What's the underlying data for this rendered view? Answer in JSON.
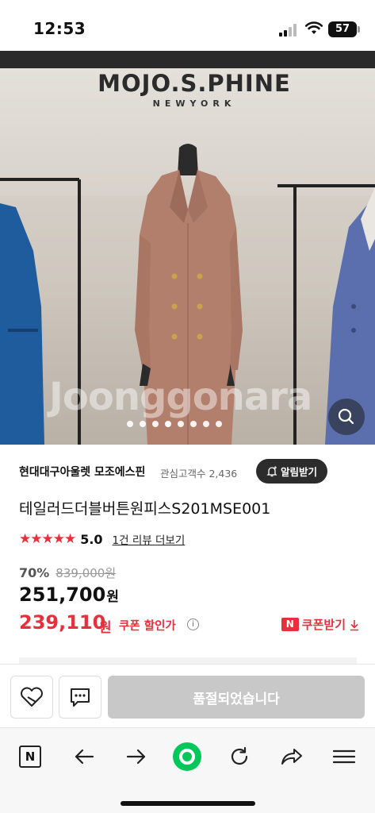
{
  "status_bar": {
    "time": "12:53",
    "battery": "57"
  },
  "hero": {
    "brand": "MOJO.S.PHINE",
    "brand_sub": "NEWYORK",
    "watermark": "Joonggonara",
    "carousel_dots": 8,
    "active_dot": 4,
    "icons": {
      "zoom": "search-icon"
    }
  },
  "store": {
    "name": "현대대구아울렛 모조에스핀",
    "followers": "관심고객수 2,436",
    "alarm_label": "알림받기"
  },
  "product": {
    "title": "테일러드더블버튼원피스S201MSE001",
    "stars": "★★★★★",
    "rating": "5.0",
    "review_link": "1건 리뷰 더보기",
    "discount": "70%",
    "original_price": "839,000원",
    "price": "251,700",
    "price_unit": "원",
    "coupon_price": "239,110",
    "coupon_unit": "원",
    "coupon_label": "쿠폰 할인가",
    "get_coupon_badge": "N",
    "get_coupon_label": "쿠폰받기"
  },
  "actions": {
    "wishlist_icon": "heart-icon",
    "chat_icon": "chat-icon",
    "soldout_label": "품절되었습니다"
  },
  "browser": {
    "home_badge": "N",
    "icons": [
      "naver-home-icon",
      "back-arrow-icon",
      "forward-arrow-icon",
      "green-dot-icon",
      "refresh-icon",
      "share-icon",
      "menu-icon"
    ]
  },
  "colors": {
    "accent_red": "#e8303c",
    "naver_green": "#03c75a",
    "soldout_gray": "#c8c8c8"
  }
}
